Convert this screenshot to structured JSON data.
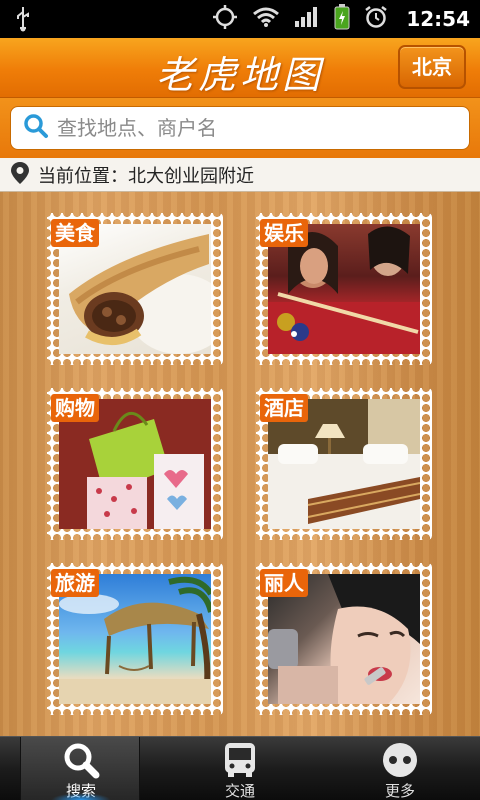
{
  "status_bar": {
    "time": "12:54"
  },
  "header": {
    "title": "老虎地图",
    "city_button": "北京"
  },
  "search": {
    "placeholder": "查找地点、商户名"
  },
  "location": {
    "text": "当前位置：北大创业园附近"
  },
  "categories": [
    {
      "label": "美食",
      "icon": "food-photo"
    },
    {
      "label": "娱乐",
      "icon": "billiards-photo"
    },
    {
      "label": "购物",
      "icon": "shopping-bags-photo"
    },
    {
      "label": "酒店",
      "icon": "hotel-room-photo"
    },
    {
      "label": "旅游",
      "icon": "beach-photo"
    },
    {
      "label": "丽人",
      "icon": "beauty-photo"
    }
  ],
  "bottom_nav": [
    {
      "label": "搜索",
      "icon": "search-icon",
      "active": true
    },
    {
      "label": "交通",
      "icon": "bus-icon",
      "active": false
    },
    {
      "label": "更多",
      "icon": "more-icon",
      "active": false
    }
  ],
  "colors": {
    "accent": "#ef7d08",
    "tag": "#e9650a",
    "wood": "#d59754"
  }
}
